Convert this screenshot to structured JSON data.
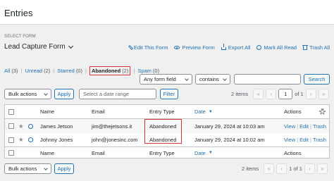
{
  "page": {
    "title": "Entries"
  },
  "form_selector": {
    "label": "SELECT FORM",
    "value": "Lead Capture Form"
  },
  "actions": [
    {
      "label": "Edit This Form",
      "icon": "edit-icon"
    },
    {
      "label": "Preview Form",
      "icon": "eye-icon"
    },
    {
      "label": "Export All",
      "icon": "export-icon"
    },
    {
      "label": "Mark All Read",
      "icon": "check-circle-icon"
    },
    {
      "label": "Trash All",
      "icon": "trash-icon"
    }
  ],
  "status_filters": {
    "all": {
      "label": "All",
      "count": "(3)"
    },
    "unread": {
      "label": "Unread",
      "count": "(2)"
    },
    "starred": {
      "label": "Starred",
      "count": "(0)"
    },
    "abandoned": {
      "label": "Abandoned",
      "count": "(2)"
    },
    "spam": {
      "label": "Spam",
      "count": "(0)"
    }
  },
  "search": {
    "field_select": "Any form field",
    "operator_select": "contains",
    "value": "",
    "button": "Search"
  },
  "top_nav": {
    "bulk_actions": "Bulk actions",
    "apply": "Apply",
    "date_placeholder": "Select a date range",
    "filter": "Filter",
    "items": "2 items",
    "first": "«",
    "prev": "‹",
    "page": "1",
    "of_pages": "of 1",
    "next": "›",
    "last": "»"
  },
  "table": {
    "columns": {
      "name": "Name",
      "email": "Email",
      "entry_type": "Entry Type",
      "date": "Date",
      "actions": "Actions"
    },
    "rows": [
      {
        "name": "James Jetson",
        "email": "jim@thejetsons.it",
        "entry_type": "Abandoned",
        "date": "January 29, 2024 at 10:03 am"
      },
      {
        "name": "Johnny Jones",
        "email": "john@jonesinc.com",
        "entry_type": "Abandoned",
        "date": "January 29, 2024 at 10:02 am"
      }
    ],
    "row_actions": {
      "view": "View",
      "edit": "Edit",
      "trash": "Trash"
    },
    "star_glyph": "★"
  },
  "bottom_nav": {
    "bulk_actions": "Bulk actions",
    "apply": "Apply",
    "items": "2 items",
    "first": "«",
    "prev": "‹",
    "page": "1",
    "of_pages": "of 1",
    "next": "›",
    "last": "»"
  },
  "colors": {
    "accent": "#2271b1",
    "highlight": "#d63638"
  }
}
